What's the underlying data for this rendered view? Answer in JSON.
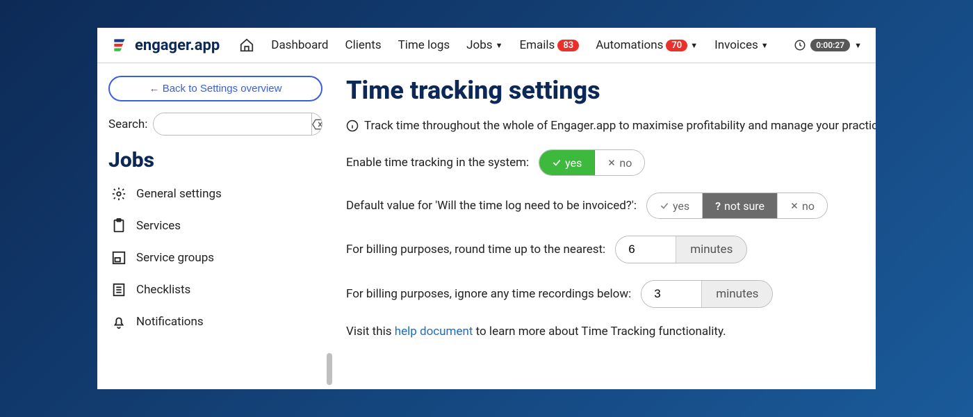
{
  "brand": {
    "name": "engager.app"
  },
  "nav": {
    "dashboard": "Dashboard",
    "clients": "Clients",
    "timelogs": "Time logs",
    "jobs": "Jobs",
    "emails": "Emails",
    "emails_badge": "83",
    "automations": "Automations",
    "automations_badge": "70",
    "invoices": "Invoices",
    "timer": "0:00:27"
  },
  "sidebar": {
    "back": "← Back to Settings overview",
    "search_label": "Search:",
    "heading": "Jobs",
    "items": [
      {
        "label": "General settings"
      },
      {
        "label": "Services"
      },
      {
        "label": "Service groups"
      },
      {
        "label": "Checklists"
      },
      {
        "label": "Notifications"
      }
    ]
  },
  "page": {
    "title": "Time tracking settings",
    "intro": "Track time throughout the whole of Engager.app to maximise profitability and manage your practice e",
    "enable_label": "Enable time tracking in the system:",
    "enable_yes": "yes",
    "enable_no": "no",
    "default_label": "Default value for 'Will the time log need to be invoiced?':",
    "opt_yes": "yes",
    "opt_notsure": "not sure",
    "opt_no": "no",
    "round_label": "For billing purposes, round time up to the nearest:",
    "round_value": "6",
    "round_unit": "minutes",
    "ignore_label": "For billing purposes, ignore any time recordings below:",
    "ignore_value": "3",
    "ignore_unit": "minutes",
    "visit_pre": "Visit this ",
    "visit_link": "help document",
    "visit_post": " to learn more about Time Tracking functionality."
  }
}
